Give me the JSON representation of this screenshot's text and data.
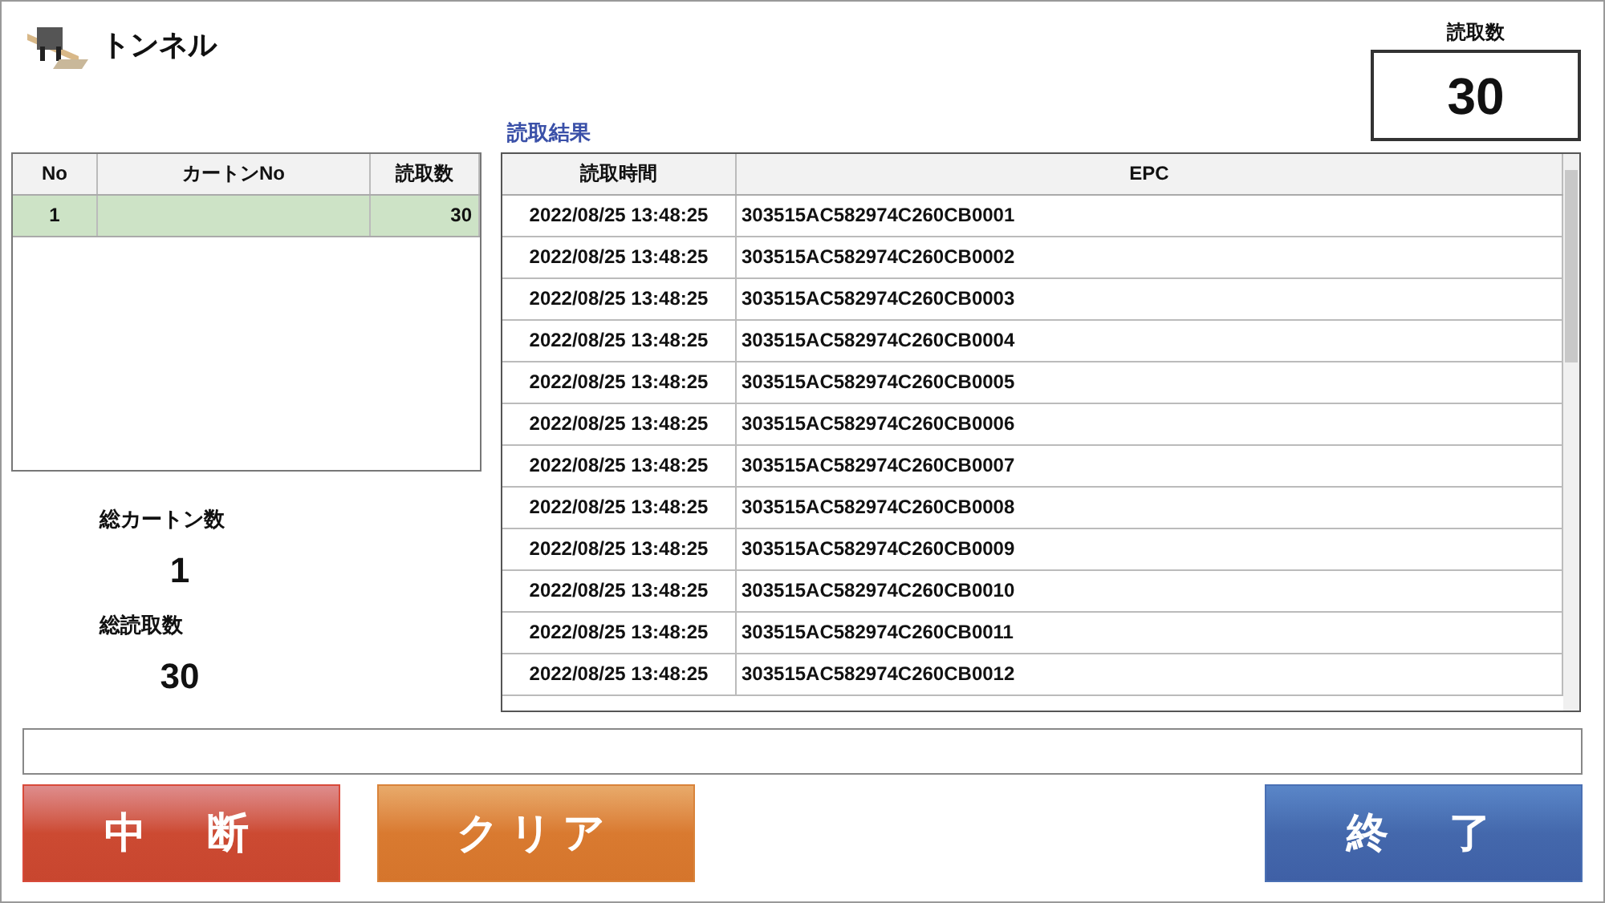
{
  "window": {
    "title": "トンネル"
  },
  "read_count": {
    "label": "読取数",
    "value": "30"
  },
  "carton_table": {
    "columns": [
      "No",
      "カートンNo",
      "読取数"
    ],
    "rows": [
      {
        "cells": [
          "1",
          "",
          "30"
        ],
        "selected": true
      }
    ]
  },
  "summary": [
    {
      "label": "総カートン数",
      "value": "1"
    },
    {
      "label": "総読取数",
      "value": "30"
    }
  ],
  "results": {
    "title": "読取結果",
    "columns": [
      "読取時間",
      "EPC"
    ],
    "rows": [
      [
        "2022/08/25 13:48:25",
        "303515AC582974C260CB0001"
      ],
      [
        "2022/08/25 13:48:25",
        "303515AC582974C260CB0002"
      ],
      [
        "2022/08/25 13:48:25",
        "303515AC582974C260CB0003"
      ],
      [
        "2022/08/25 13:48:25",
        "303515AC582974C260CB0004"
      ],
      [
        "2022/08/25 13:48:25",
        "303515AC582974C260CB0005"
      ],
      [
        "2022/08/25 13:48:25",
        "303515AC582974C260CB0006"
      ],
      [
        "2022/08/25 13:48:25",
        "303515AC582974C260CB0007"
      ],
      [
        "2022/08/25 13:48:25",
        "303515AC582974C260CB0008"
      ],
      [
        "2022/08/25 13:48:25",
        "303515AC582974C260CB0009"
      ],
      [
        "2022/08/25 13:48:25",
        "303515AC582974C260CB0010"
      ],
      [
        "2022/08/25 13:48:25",
        "303515AC582974C260CB0011"
      ],
      [
        "2022/08/25 13:48:25",
        "303515AC582974C260CB0012"
      ]
    ]
  },
  "buttons": [
    {
      "label": "中　断",
      "kind": "red"
    },
    {
      "label": "クリア",
      "kind": "orange"
    },
    {
      "label": "終　了",
      "kind": "blue"
    }
  ]
}
